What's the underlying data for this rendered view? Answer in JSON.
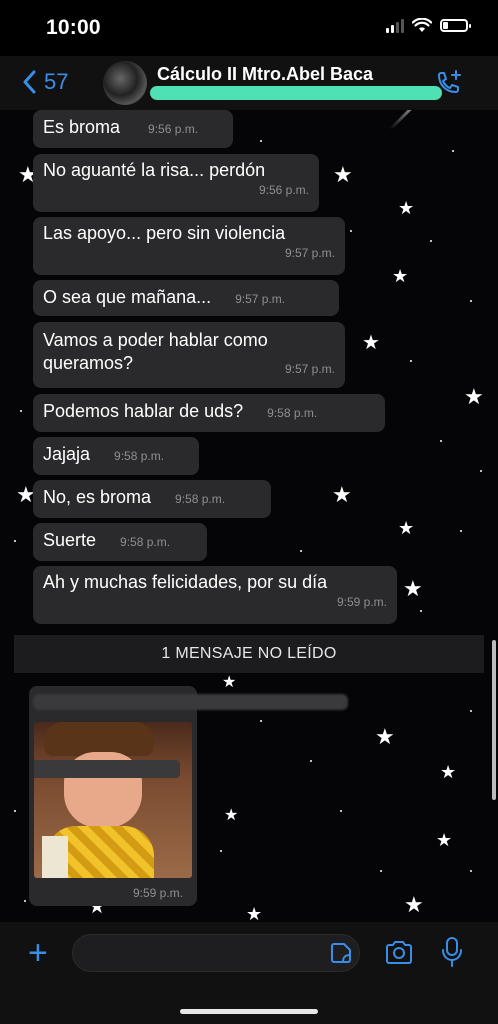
{
  "status": {
    "time": "10:00"
  },
  "header": {
    "back_count": "57",
    "title": "Cálculo II Mtro.Abel Baca"
  },
  "messages": [
    {
      "text": "Es broma",
      "time": "9:56 p.m."
    },
    {
      "text": "No aguanté la risa... perdón",
      "time": "9:56 p.m."
    },
    {
      "text": "Las apoyo... pero sin violencia",
      "time": "9:57 p.m."
    },
    {
      "text": "O sea que mañana...",
      "time": "9:57 p.m."
    },
    {
      "text": "Vamos a poder hablar como queramos?",
      "time": "9:57 p.m."
    },
    {
      "text": "Podemos hablar de uds?",
      "time": "9:58 p.m."
    },
    {
      "text": "Jajaja",
      "time": "9:58 p.m."
    },
    {
      "text": "No, es broma",
      "time": "9:58 p.m."
    },
    {
      "text": "Suerte",
      "time": "9:58 p.m."
    },
    {
      "text": "Ah y muchas felicidades, por su día",
      "time": "9:59 p.m."
    }
  ],
  "unread_divider": "1 MENSAJE NO LEÍDO",
  "media_message": {
    "time": "9:59 p.m."
  },
  "colors": {
    "accent": "#3a8ee6",
    "bubble": "#2a2a2c",
    "redaction": "#4fe0b4"
  }
}
